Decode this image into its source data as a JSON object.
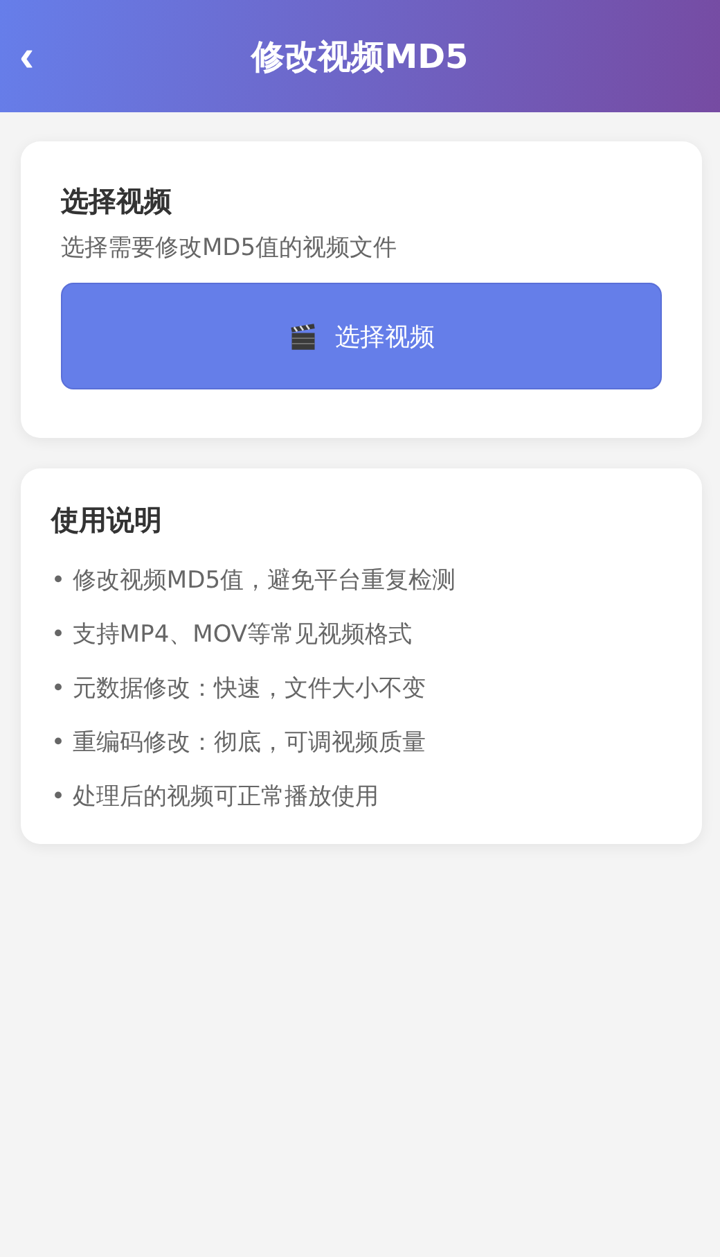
{
  "header": {
    "back": "‹",
    "title": "修改视频MD5"
  },
  "select_card": {
    "title": "选择视频",
    "subtitle": "选择需要修改MD5值的视频文件",
    "button": "选择视频"
  },
  "usage_card": {
    "title": "使用说明",
    "items": [
      "• 修改视频MD5值，避免平台重复检测",
      "• 支持MP4、MOV等常见视频格式",
      "• 元数据修改：快速，文件大小不变",
      "• 重编码修改：彻底，可调视频质量",
      "• 处理后的视频可正常播放使用"
    ]
  }
}
